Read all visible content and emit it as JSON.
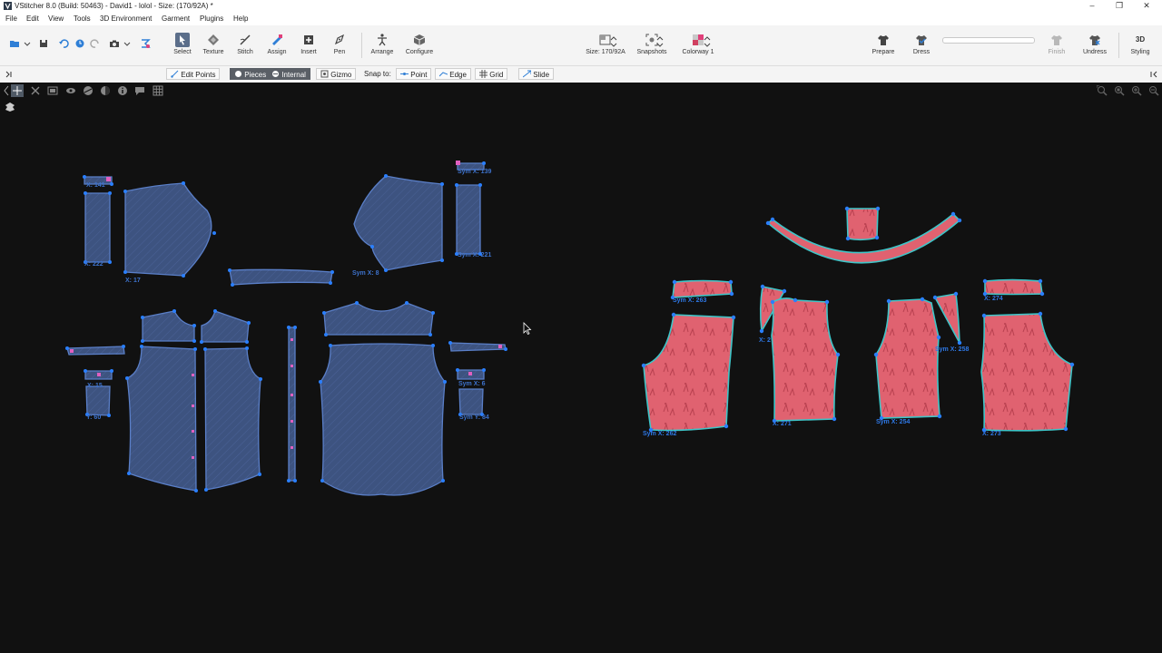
{
  "window": {
    "title": "VStitcher 8.0 (Build: 50463) - David1 - lolol - Size: (170/92A) *",
    "controls": [
      "–",
      "❐",
      "✕"
    ]
  },
  "menu": [
    "File",
    "Edit",
    "View",
    "Tools",
    "3D Environment",
    "Garment",
    "Plugins",
    "Help"
  ],
  "toolbar": {
    "select": "Select",
    "texture": "Texture",
    "stitch": "Stitch",
    "assign": "Assign",
    "insert": "Insert",
    "pen": "Pen",
    "arrange": "Arrange",
    "configure": "Configure",
    "size": "Size: 170/92A",
    "snapshots": "Snapshots",
    "colorway": "Colorway 1",
    "prepare": "Prepare",
    "dress": "Dress",
    "finish": "Finish",
    "undress": "Undress",
    "styling": "Styling",
    "styling_mode": "3D"
  },
  "subbar": {
    "edit_points": "Edit Points",
    "pieces": "Pieces",
    "internal": "Internal",
    "gizmo": "Gizmo",
    "snap_to": "Snap to:",
    "point": "Point",
    "edge": "Edge",
    "grid": "Grid",
    "slide": "Slide"
  },
  "colors": {
    "shirt_fill": "#3f5580",
    "shirt_stroke": "#5a7fc8",
    "vertex": "#2a7fff",
    "pants_fill": "#e06270",
    "pants_stroke": "#3ec5c8",
    "pin": "#e060c0"
  },
  "labels": {
    "l141": "X: 141",
    "l222": "X: 222",
    "l17": "X: 17",
    "l8": "Sym X: 8",
    "l139": "Sym X: 139",
    "l221": "Sym X: 221",
    "l_ls": "X: 15",
    "l_ly": "Y: 60",
    "l_rs": "Sym X: 6",
    "l_ry": "Sym Y: 84",
    "l263": "Sym X: 263",
    "l262": "Sym X: 262",
    "l2xx": "X: 2",
    "l271": "X: 271",
    "l254": "Sym X: 254",
    "l258": "Sym X: 258",
    "l274": "X: 274",
    "l273": "X: 273"
  }
}
